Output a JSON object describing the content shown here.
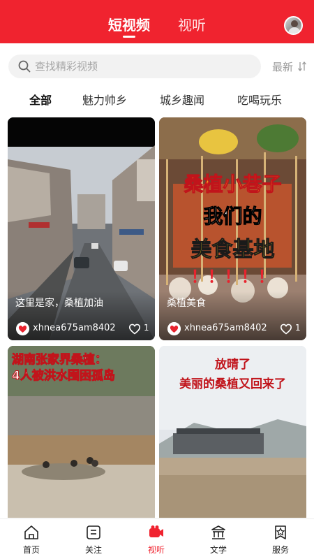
{
  "header": {
    "tabs": [
      {
        "label": "短视频",
        "active": true
      },
      {
        "label": "视听",
        "active": false
      }
    ],
    "accent_color": "#f0232f"
  },
  "search": {
    "placeholder": "查找精彩视频",
    "sort_label": "最新"
  },
  "categories": [
    "全部",
    "魅力帅乡",
    "城乡趣闻",
    "吃喝玩乐"
  ],
  "active_category": "全部",
  "cards": [
    {
      "caption": "这里是家，桑植加油",
      "user": "xhnea675am8402",
      "likes": "1"
    },
    {
      "caption": "桑植美食",
      "user": "xhnea675am8402",
      "likes": "1",
      "overlay_lines": [
        "桑植小巷子",
        "我们的",
        "美食基地",
        "！！！！！"
      ]
    },
    {
      "overlay_lines": [
        "湖南张家界桑植：",
        "4人被洪水围困孤岛"
      ]
    },
    {
      "overlay_lines": [
        "放晴了",
        "美丽的桑植又回来了"
      ]
    }
  ],
  "bottom_nav": [
    {
      "label": "首页",
      "icon": "home-icon"
    },
    {
      "label": "关注",
      "icon": "follow-icon"
    },
    {
      "label": "视听",
      "icon": "video-icon",
      "active": true
    },
    {
      "label": "文学",
      "icon": "literature-icon"
    },
    {
      "label": "服务",
      "icon": "service-icon"
    }
  ]
}
